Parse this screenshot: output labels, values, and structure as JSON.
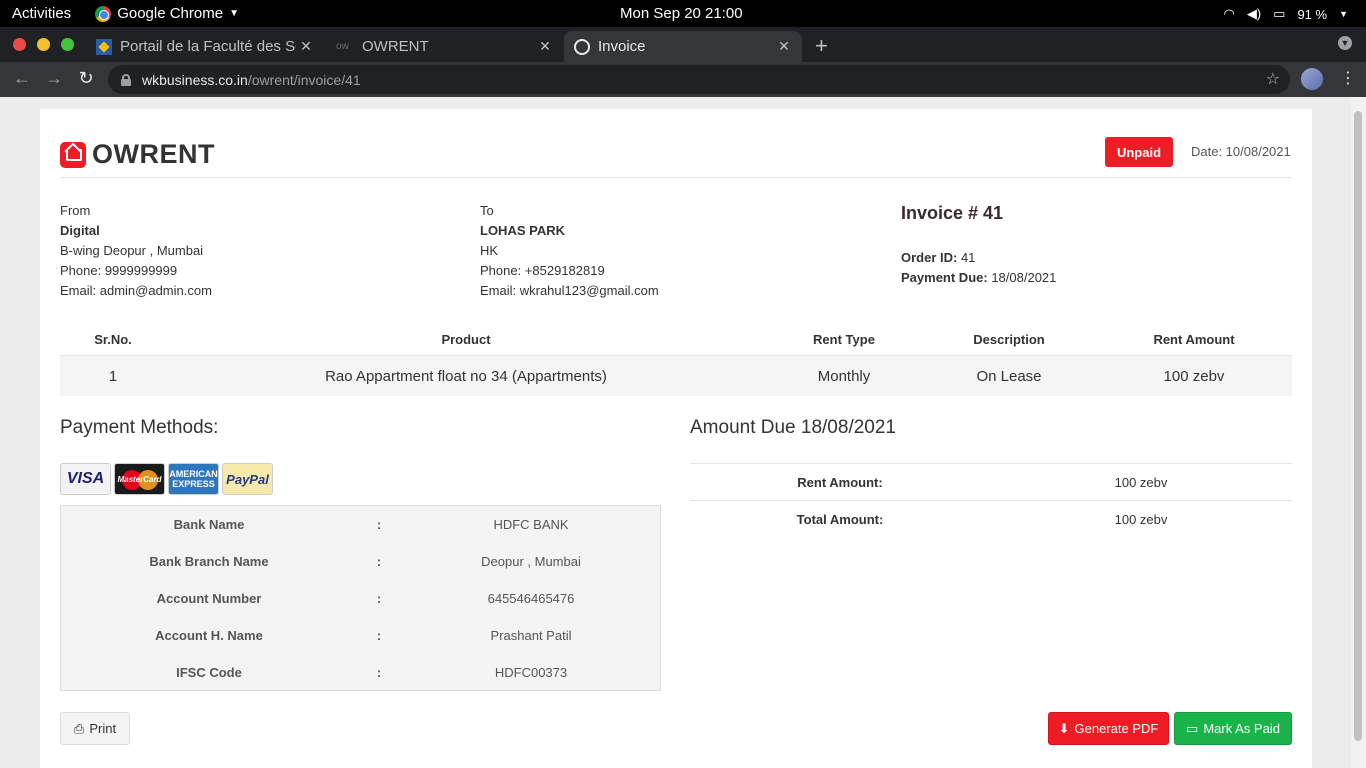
{
  "os": {
    "activities": "Activities",
    "app_name": "Google Chrome",
    "clock": "Mon Sep 20  21:00",
    "battery": "91 %"
  },
  "tabs": [
    {
      "title": "Portail de la Faculté des Sc",
      "favicon": "school-favicon"
    },
    {
      "title": "OWRENT",
      "favicon": "ow"
    },
    {
      "title": "Invoice",
      "favicon": "globe-icon"
    }
  ],
  "address_bar": {
    "host": "wkbusiness.co.in",
    "path": "/owrent/invoice/41"
  },
  "invoice": {
    "brand": "OWRENT",
    "status": "Unpaid",
    "date": "Date: 10/08/2021",
    "from": {
      "label": "From",
      "name": "Digital",
      "address": "B-wing Deopur , Mumbai",
      "phone": "Phone: 9999999999",
      "email": "Email: admin@admin.com"
    },
    "to": {
      "label": "To",
      "name": "LOHAS PARK",
      "address": "HK",
      "phone": "Phone: +8529182819",
      "email": "Email: wkrahul123@gmail.com"
    },
    "title": "Invoice # 41",
    "order_id_label": "Order ID:",
    "order_id": " 41",
    "payment_due_label": "Payment Due:",
    "payment_due": " 18/08/2021"
  },
  "table": {
    "headers": [
      "Sr.No.",
      "Product",
      "Rent Type",
      "Description",
      "Rent Amount"
    ],
    "rows": [
      [
        "1",
        "Rao Appartment float no 34 (Appartments)",
        "Monthly",
        "On Lease",
        "100 zebv"
      ]
    ]
  },
  "payment": {
    "heading": "Payment Methods:",
    "cards": [
      "VISA",
      "MasterCard",
      "AMERICAN EXPRESS",
      "PayPal"
    ],
    "bank": [
      {
        "label": "Bank Name",
        "value": "HDFC BANK"
      },
      {
        "label": "Bank Branch Name",
        "value": "Deopur , Mumbai"
      },
      {
        "label": "Account Number",
        "value": "645546465476"
      },
      {
        "label": "Account H. Name",
        "value": "Prashant Patil"
      },
      {
        "label": "IFSC Code",
        "value": "HDFC00373"
      }
    ],
    "separator": ":"
  },
  "amount": {
    "heading": "Amount Due 18/08/2021",
    "rows": [
      {
        "label": "Rent Amount:",
        "value": "100 zebv"
      },
      {
        "label": "Total Amount:",
        "value": "100 zebv"
      }
    ]
  },
  "buttons": {
    "print": "Print",
    "generate_pdf": "Generate PDF",
    "mark_paid": "Mark As Paid"
  }
}
